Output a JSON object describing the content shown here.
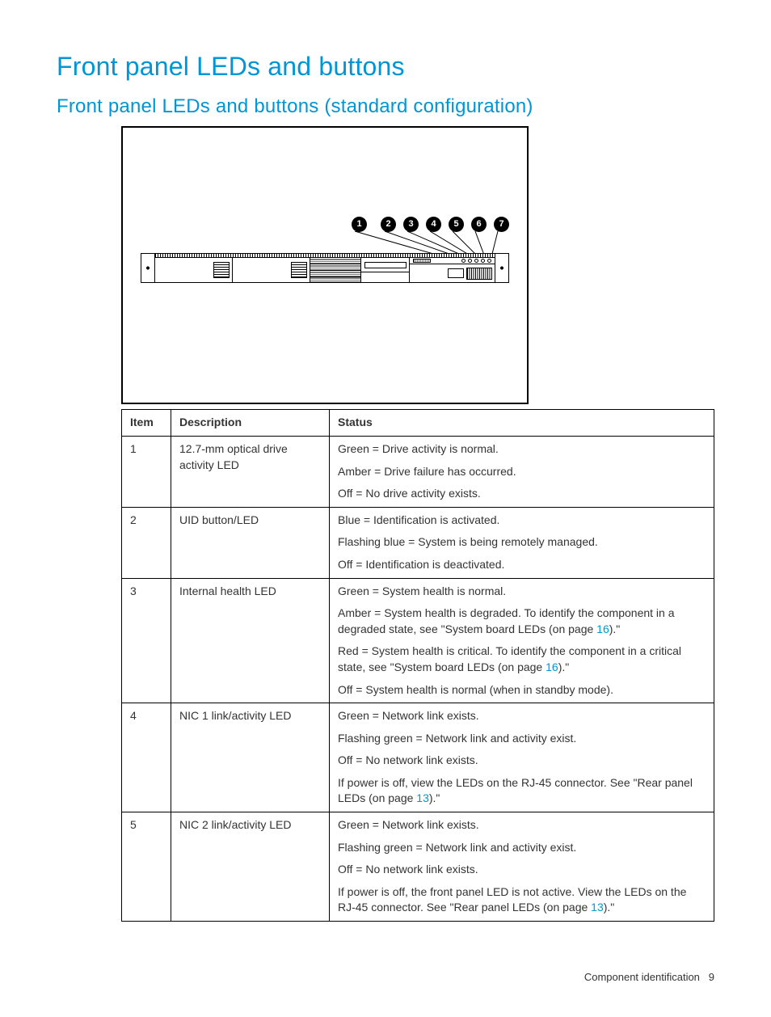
{
  "heading": "Front panel LEDs and buttons",
  "subheading": "Front panel LEDs and buttons (standard configuration)",
  "callouts": [
    "1",
    "2",
    "3",
    "4",
    "5",
    "6",
    "7"
  ],
  "table": {
    "headers": {
      "item": "Item",
      "description": "Description",
      "status": "Status"
    },
    "rows": [
      {
        "item": "1",
        "description": "12.7-mm optical drive activity LED",
        "status": [
          {
            "text": "Green = Drive activity is normal."
          },
          {
            "text": "Amber = Drive failure has occurred."
          },
          {
            "text": "Off = No drive activity exists."
          }
        ]
      },
      {
        "item": "2",
        "description": "UID button/LED",
        "status": [
          {
            "text": "Blue = Identification is activated."
          },
          {
            "text": "Flashing blue = System is being remotely managed."
          },
          {
            "text": "Off = Identification is deactivated."
          }
        ]
      },
      {
        "item": "3",
        "description": "Internal health LED",
        "status": [
          {
            "text": "Green = System health is normal."
          },
          {
            "pre": "Amber = System health is degraded. To identify the component in a degraded state, see \"System board LEDs (on page ",
            "link": "16",
            "post": ").\""
          },
          {
            "pre": "Red = System health is critical. To identify the component in a critical state, see \"System board LEDs (on page ",
            "link": "16",
            "post": ").\""
          },
          {
            "text": "Off = System health is normal (when in standby mode)."
          }
        ]
      },
      {
        "item": "4",
        "description": "NIC 1 link/activity LED",
        "status": [
          {
            "text": "Green = Network link exists."
          },
          {
            "text": "Flashing green = Network link and activity exist."
          },
          {
            "text": "Off = No network link exists."
          },
          {
            "pre": "If power is off, view the LEDs on the RJ-45 connector. See \"Rear panel LEDs (on page ",
            "link": "13",
            "post": ").\""
          }
        ]
      },
      {
        "item": "5",
        "description": "NIC 2 link/activity LED",
        "status": [
          {
            "text": "Green = Network link exists."
          },
          {
            "text": "Flashing green = Network link and activity exist."
          },
          {
            "text": "Off = No network link exists."
          },
          {
            "pre": "If power is off, the front panel LED is not active. View the LEDs on the RJ-45 connector. See \"Rear panel LEDs (on page ",
            "link": "13",
            "post": ").\""
          }
        ]
      }
    ]
  },
  "footer": {
    "section": "Component identification",
    "page": "9"
  }
}
